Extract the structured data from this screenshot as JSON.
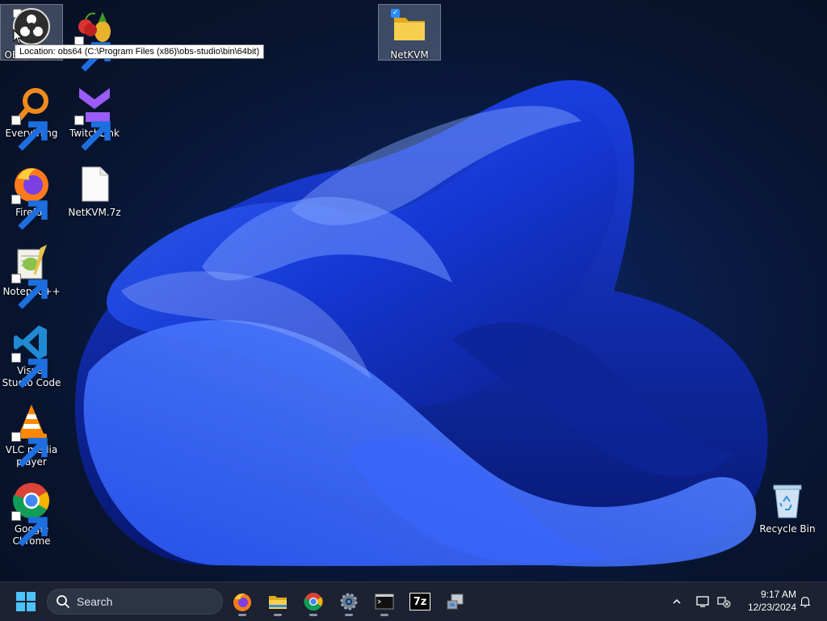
{
  "desktop": {
    "icons": [
      {
        "label": "OBS Studio",
        "icon": "obs-icon"
      },
      {
        "label": "",
        "icon": "cherry-pineapple-icon"
      },
      {
        "label": "NetKVM",
        "icon": "folder-icon"
      },
      {
        "label": "Everything",
        "icon": "magnifier-icon"
      },
      {
        "label": "TwitchLink",
        "icon": "twitchlink-icon"
      },
      {
        "label": "Firefox",
        "icon": "firefox-icon"
      },
      {
        "label": "NetKVM.7z",
        "icon": "file-icon"
      },
      {
        "label": "Notepad++",
        "icon": "notepadpp-icon"
      },
      {
        "label": "Visual Studio Code",
        "icon": "vscode-icon"
      },
      {
        "label": "VLC media player",
        "icon": "vlc-icon"
      },
      {
        "label": "Google Chrome",
        "icon": "chrome-icon"
      },
      {
        "label": "Recycle Bin",
        "icon": "recycle-bin-icon"
      }
    ],
    "tooltip": "Location: obs64 (C:\\Program Files (x86)\\obs-studio\\bin\\64bit)"
  },
  "taskbar": {
    "search_placeholder": "Search",
    "pinned": [
      "firefox-icon",
      "file-explorer-icon",
      "chrome-icon",
      "settings-icon",
      "terminal-icon",
      "7zip-icon",
      "device-manager-icon"
    ],
    "clock": {
      "time": "9:17 AM",
      "date": "12/23/2024"
    },
    "seven_zip_label": "7z"
  },
  "colors": {
    "taskbar_bg": "#1c2231",
    "accent": "#2a8cff"
  }
}
